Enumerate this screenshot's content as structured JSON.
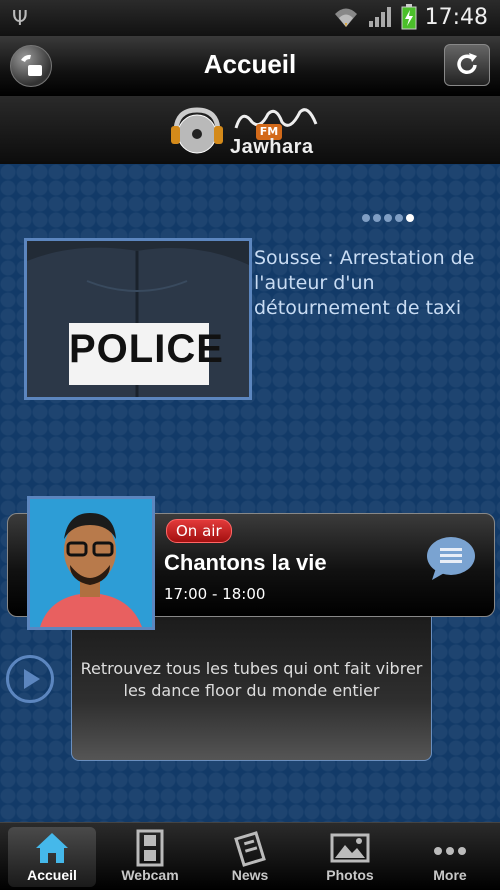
{
  "status_bar": {
    "time": "17:48"
  },
  "header": {
    "title": "Accueil"
  },
  "logo": {
    "text": "Jawhara",
    "badge": "FM"
  },
  "carousel": {
    "page_count": 5,
    "active_index": 4
  },
  "news": {
    "title": "Sousse : Arrestation de l'auteur d'un détournement de taxi",
    "thumb_text": "POLICE"
  },
  "now_playing": {
    "badge": "On air",
    "title": "Chantons la vie",
    "time": "17:00 - 18:00",
    "description": "Retrouvez tous les tubes qui ont fait vibrer les dance floor du monde entier"
  },
  "tabs": [
    {
      "label": "Accueil",
      "icon": "home-icon",
      "active": true
    },
    {
      "label": "Webcam",
      "icon": "film-icon",
      "active": false
    },
    {
      "label": "News",
      "icon": "newspaper-icon",
      "active": false
    },
    {
      "label": "Photos",
      "icon": "photo-icon",
      "active": false
    },
    {
      "label": "More",
      "icon": "more-icon",
      "active": false
    }
  ],
  "colors": {
    "accent": "#5c86bf",
    "on_air": "#c61c1c",
    "background": "#123a68"
  }
}
